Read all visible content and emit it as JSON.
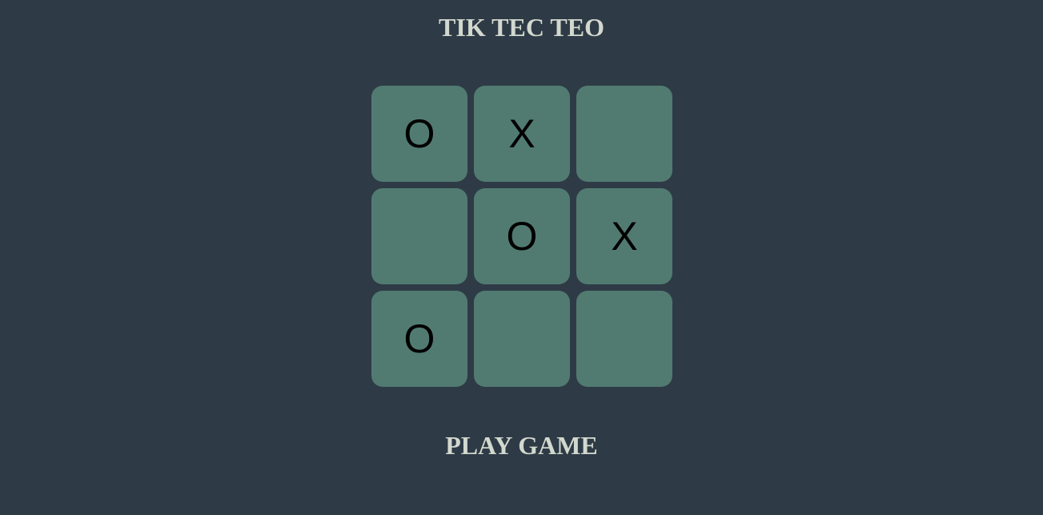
{
  "title": "TIK TEC TEO",
  "board": {
    "cells": [
      "O",
      "X",
      "",
      "",
      "O",
      "X",
      "O",
      "",
      ""
    ]
  },
  "play_button_label": "PLAY GAME",
  "colors": {
    "background": "#2e3b46",
    "cell": "#517b71",
    "heading_text": "#d3d8cf",
    "mark": "#000000"
  }
}
